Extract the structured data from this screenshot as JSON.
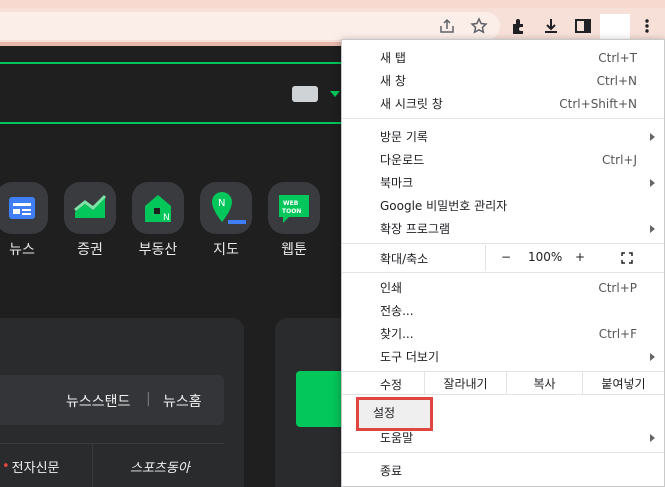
{
  "menu": {
    "new_tab": {
      "label": "새 탭",
      "shortcut": "Ctrl+T"
    },
    "new_window": {
      "label": "새 창",
      "shortcut": "Ctrl+N"
    },
    "incognito": {
      "label": "새 시크릿 창",
      "shortcut": "Ctrl+Shift+N"
    },
    "history": {
      "label": "방문 기록"
    },
    "downloads": {
      "label": "다운로드",
      "shortcut": "Ctrl+J"
    },
    "bookmarks": {
      "label": "북마크"
    },
    "passwords": {
      "label": "Google 비밀번호 관리자"
    },
    "extensions": {
      "label": "확장 프로그램"
    },
    "zoom": {
      "label": "확대/축소",
      "minus": "−",
      "value": "100%",
      "plus": "+"
    },
    "print": {
      "label": "인쇄",
      "shortcut": "Ctrl+P"
    },
    "cast": {
      "label": "전송..."
    },
    "find": {
      "label": "찾기...",
      "shortcut": "Ctrl+F"
    },
    "more_tools": {
      "label": "도구 더보기"
    },
    "edit": {
      "label": "수정",
      "cut": "잘라내기",
      "copy": "복사",
      "paste": "붙여넣기"
    },
    "settings": {
      "label": "설정"
    },
    "help": {
      "label": "도움말"
    },
    "exit": {
      "label": "종료"
    }
  },
  "page": {
    "services": [
      {
        "label": "뉴스"
      },
      {
        "label": "증권"
      },
      {
        "label": "부동산"
      },
      {
        "label": "지도"
      },
      {
        "label": "웹툰"
      }
    ],
    "webtoon_icon_text": "WEB TOON",
    "newsbar": {
      "newsstand": "뉴스스탠드",
      "separator": "|",
      "newshome": "뉴스홈"
    },
    "news_sources": {
      "left": "전자신문",
      "right": "스포츠동아"
    }
  },
  "colors": {
    "accent": "#03c75a",
    "highlight": "#e0463f"
  }
}
